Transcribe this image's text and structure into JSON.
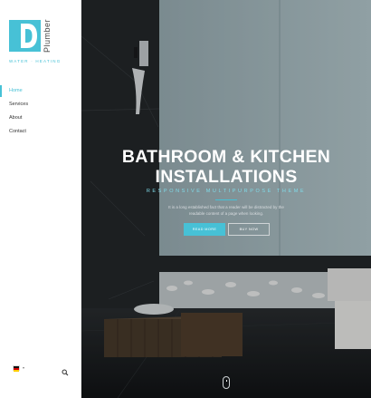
{
  "brand": {
    "name": "Plumber",
    "tagline": "WATER · HEATING",
    "accent": "#47c1d6"
  },
  "nav": {
    "items": [
      {
        "label": "Home",
        "active": true
      },
      {
        "label": "Services",
        "active": false
      },
      {
        "label": "About",
        "active": false
      },
      {
        "label": "Contact",
        "active": false
      }
    ]
  },
  "footer": {
    "language_flag": "de-flag-icon",
    "language_caret": "▾",
    "search_icon": "search-icon"
  },
  "hero": {
    "title": "BATHROOM & KITCHEN\nINSTALLATIONS",
    "subtitle": "RESPONSIVE MULTIPURPOSE THEME",
    "description": "It is a long established fact that a reader will be distracted by the readable content of a page when looking.",
    "primary_button": "READ MORE",
    "secondary_button": "BUY NOW",
    "scroll_icon": "mouse-scroll-icon"
  }
}
